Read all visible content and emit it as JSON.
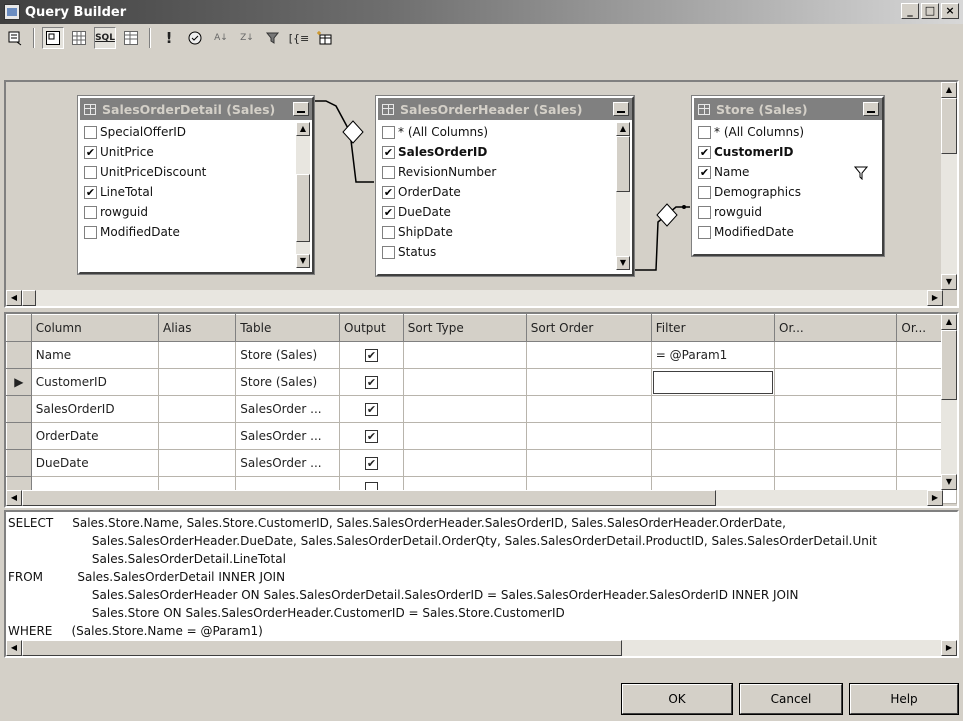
{
  "window": {
    "title": "Query Builder",
    "controls": [
      "_",
      "□",
      "×"
    ]
  },
  "toolbar": {
    "buttons": [
      "diagram-pane-toggle",
      "grid-pane-toggle",
      "sql-pane-toggle",
      "results-pane-toggle",
      "run-query",
      "verify-sql",
      "sort-ascending",
      "sort-descending",
      "remove-filter",
      "group-by",
      "add-table"
    ],
    "sql_label": "SQL"
  },
  "diagram": {
    "tables": [
      {
        "title": "SalesOrderDetail (Sales)",
        "columns": [
          {
            "name": "SpecialOfferID",
            "checked": false
          },
          {
            "name": "UnitPrice",
            "checked": true
          },
          {
            "name": "UnitPriceDiscount",
            "checked": false
          },
          {
            "name": "LineTotal",
            "checked": true
          },
          {
            "name": "rowguid",
            "checked": false
          },
          {
            "name": "ModifiedDate",
            "checked": false
          }
        ]
      },
      {
        "title": "SalesOrderHeader (Sales)",
        "columns": [
          {
            "name": "* (All Columns)",
            "checked": false
          },
          {
            "name": "SalesOrderID",
            "checked": true
          },
          {
            "name": "RevisionNumber",
            "checked": false
          },
          {
            "name": "OrderDate",
            "checked": true
          },
          {
            "name": "DueDate",
            "checked": true
          },
          {
            "name": "ShipDate",
            "checked": false
          },
          {
            "name": "Status",
            "checked": false
          }
        ]
      },
      {
        "title": "Store (Sales)",
        "columns": [
          {
            "name": "* (All Columns)",
            "checked": false
          },
          {
            "name": "CustomerID",
            "checked": true
          },
          {
            "name": "Name",
            "checked": true
          },
          {
            "name": "Demographics",
            "checked": false
          },
          {
            "name": "rowguid",
            "checked": false
          },
          {
            "name": "ModifiedDate",
            "checked": false
          }
        ]
      }
    ]
  },
  "grid": {
    "headers": [
      "Column",
      "Alias",
      "Table",
      "Output",
      "Sort Type",
      "Sort Order",
      "Filter",
      "Or...",
      "Or..."
    ],
    "rows": [
      {
        "column": "Name",
        "alias": "",
        "table": "Store (Sales)",
        "output": true,
        "filter": "= @Param1"
      },
      {
        "column": "CustomerID",
        "alias": "",
        "table": "Store (Sales)",
        "output": true,
        "filter": ""
      },
      {
        "column": "SalesOrderID",
        "alias": "",
        "table": "SalesOrder ...",
        "output": true,
        "filter": ""
      },
      {
        "column": "OrderDate",
        "alias": "",
        "table": "SalesOrder ...",
        "output": true,
        "filter": ""
      },
      {
        "column": "DueDate",
        "alias": "",
        "table": "SalesOrder ...",
        "output": true,
        "filter": ""
      },
      {
        "column": "",
        "alias": "",
        "table": "",
        "output": true,
        "filter": ""
      }
    ],
    "current_row_marker": "▶"
  },
  "sql": {
    "lines": [
      "SELECT     Sales.Store.Name, Sales.Store.CustomerID, Sales.SalesOrderHeader.SalesOrderID, Sales.SalesOrderHeader.OrderDate,",
      "                      Sales.SalesOrderHeader.DueDate, Sales.SalesOrderDetail.OrderQty, Sales.SalesOrderDetail.ProductID, Sales.SalesOrderDetail.Unit",
      "                      Sales.SalesOrderDetail.LineTotal",
      "FROM         Sales.SalesOrderDetail INNER JOIN",
      "                      Sales.SalesOrderHeader ON Sales.SalesOrderDetail.SalesOrderID = Sales.SalesOrderHeader.SalesOrderID INNER JOIN",
      "                      Sales.Store ON Sales.SalesOrderHeader.CustomerID = Sales.Store.CustomerID",
      "WHERE     (Sales.Store.Name = @Param1)"
    ]
  },
  "buttons": {
    "ok": "OK",
    "cancel": "Cancel",
    "help": "Help"
  }
}
